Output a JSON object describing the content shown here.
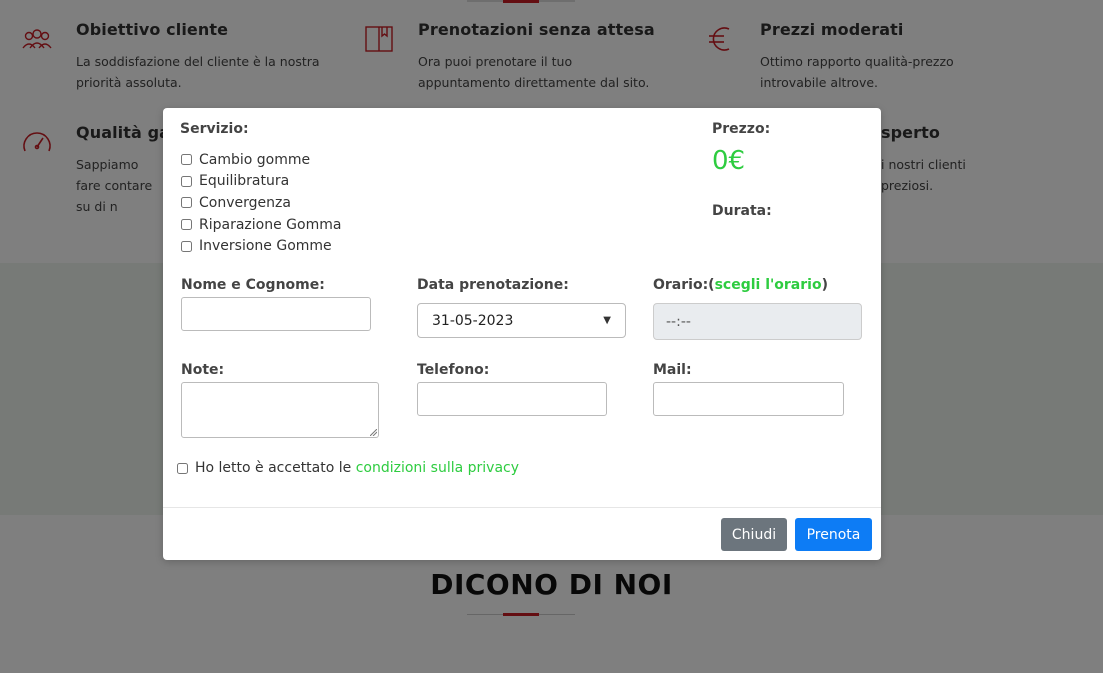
{
  "background": {
    "features": [
      {
        "title": "Obiettivo cliente",
        "text": "La soddisfazione del cliente è la nostra priorità assoluta.",
        "icon": "people-icon"
      },
      {
        "title": "Prenotazioni senza attesa",
        "text": "Ora puoi prenotare il tuo appuntamento direttamente dal sito.",
        "icon": "book-icon"
      },
      {
        "title": "Prezzi moderati",
        "text": "Ottimo rapporto qualità-prezzo introvabile altrove.",
        "icon": "euro-icon"
      },
      {
        "title": "Qualità ga",
        "text": "Sappiamo fare contare su di n",
        "icon": "speedometer-icon"
      },
      {
        "title": "sperto",
        "text": "i nostri clienti preziosi.",
        "icon": ""
      }
    ],
    "section_title": "DICONO DI NOI",
    "accent_color": "#c81d25"
  },
  "modal": {
    "service_label": "Servizio:",
    "services": [
      "Cambio gomme",
      "Equilibratura",
      "Convergenza",
      "Riparazione Gomma",
      "Inversione Gomme"
    ],
    "price_label": "Prezzo:",
    "price_value": "0€",
    "duration_label": "Durata:",
    "name_label": "Nome e Cognome:",
    "date_label": "Data prenotazione:",
    "date_value": "31-05-2023",
    "time_label_prefix": "Orario:(",
    "time_label_link": "scegli l'orario",
    "time_label_suffix": ")",
    "time_placeholder": "--:--",
    "notes_label": "Note:",
    "phone_label": "Telefono:",
    "mail_label": "Mail:",
    "privacy_text": "Ho letto è accettato le ",
    "privacy_link": "condizioni sulla privacy",
    "close_button": "Chiudi",
    "book_button": "Prenota",
    "highlight_color": "#2ecc40"
  }
}
